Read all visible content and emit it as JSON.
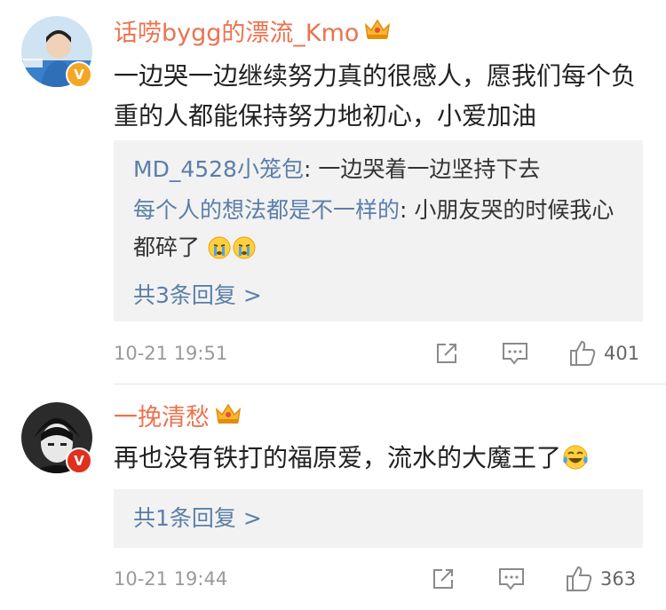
{
  "comments": [
    {
      "username": "话唠bygg的漂流_Kmo",
      "badge": "V",
      "content": "一边哭一边继续努力真的很感人，愿我们每个负重的人都能保持努力地初心，小爱加油",
      "replies": [
        {
          "name": "MD_4528小笼包",
          "sep": ": ",
          "text": "一边哭着一边坚持下去"
        },
        {
          "name": "每个人的想法都是不一样的",
          "sep": ": ",
          "text": "小朋友哭的时候我心都碎了"
        }
      ],
      "more_replies": "共3条回复 >",
      "time": "10-21 19:51",
      "likes": "401"
    },
    {
      "username": "一挽清愁",
      "badge": "V",
      "content": "再也没有铁打的福原爱，流水的大魔王了",
      "more_replies": "共1条回复 >",
      "time": "10-21 19:44",
      "likes": "363"
    }
  ],
  "icons": {
    "share": "share-icon",
    "comment": "comment-icon",
    "like": "thumbs-up-icon",
    "crown": "crown-vip-icon",
    "crying": "crying-emoji",
    "laughing": "tears-of-joy-emoji"
  },
  "colors": {
    "username": "#eb7350",
    "link": "#5b7ea9",
    "reply_bg": "#f2f2f2",
    "meta": "#9a9a9a",
    "badge_gold": "#f5a623",
    "badge_red": "#e0301e"
  }
}
